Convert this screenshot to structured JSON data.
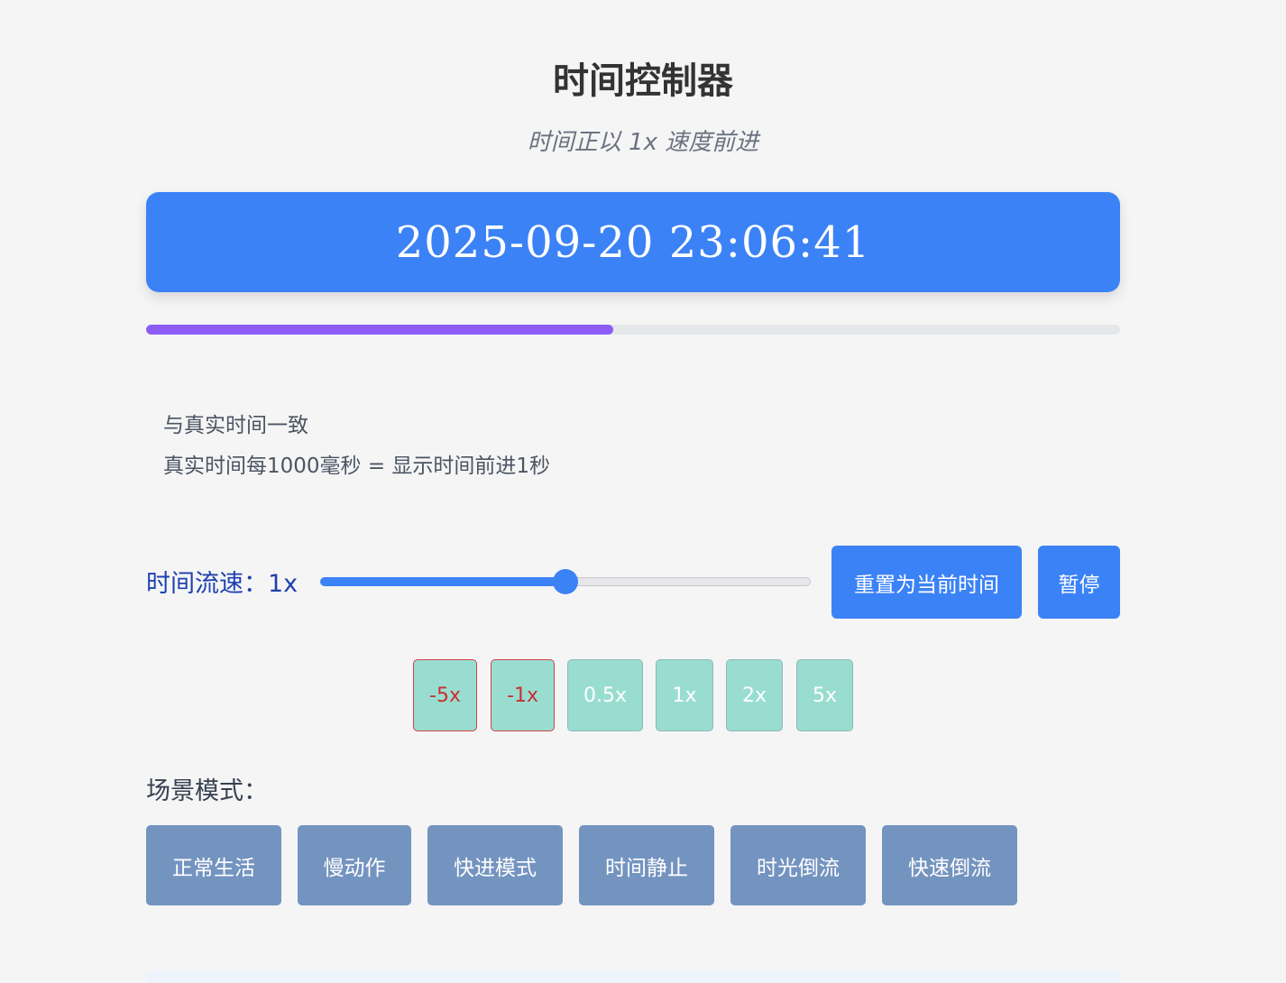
{
  "header": {
    "title": "时间控制器",
    "subtitle": "时间正以 1x 速度前进"
  },
  "clock": {
    "display": "2025-09-20 23:06:41"
  },
  "progress": {
    "value": 0.48,
    "color": "#8b5cf6"
  },
  "description": {
    "line1": "与真实时间一致",
    "line2": "真实时间每1000毫秒 = 显示时间前进1秒"
  },
  "speed": {
    "label": "时间流速：1x",
    "slider_value": 0.5
  },
  "actions": {
    "reset_label": "重置为当前时间",
    "pause_label": "暂停"
  },
  "presets": [
    {
      "label": "-5x",
      "negative": true
    },
    {
      "label": "-1x",
      "negative": true
    },
    {
      "label": "0.5x",
      "negative": false
    },
    {
      "label": "1x",
      "negative": false
    },
    {
      "label": "2x",
      "negative": false
    },
    {
      "label": "5x",
      "negative": false
    }
  ],
  "scenes": {
    "label": "场景模式：",
    "items": [
      "正常生活",
      "慢动作",
      "快进模式",
      "时间静止",
      "时光倒流",
      "快速倒流"
    ]
  },
  "colors": {
    "primary": "#3b82f6",
    "scene_button": "#7494c0",
    "preset_bg": "#99ddd1"
  }
}
